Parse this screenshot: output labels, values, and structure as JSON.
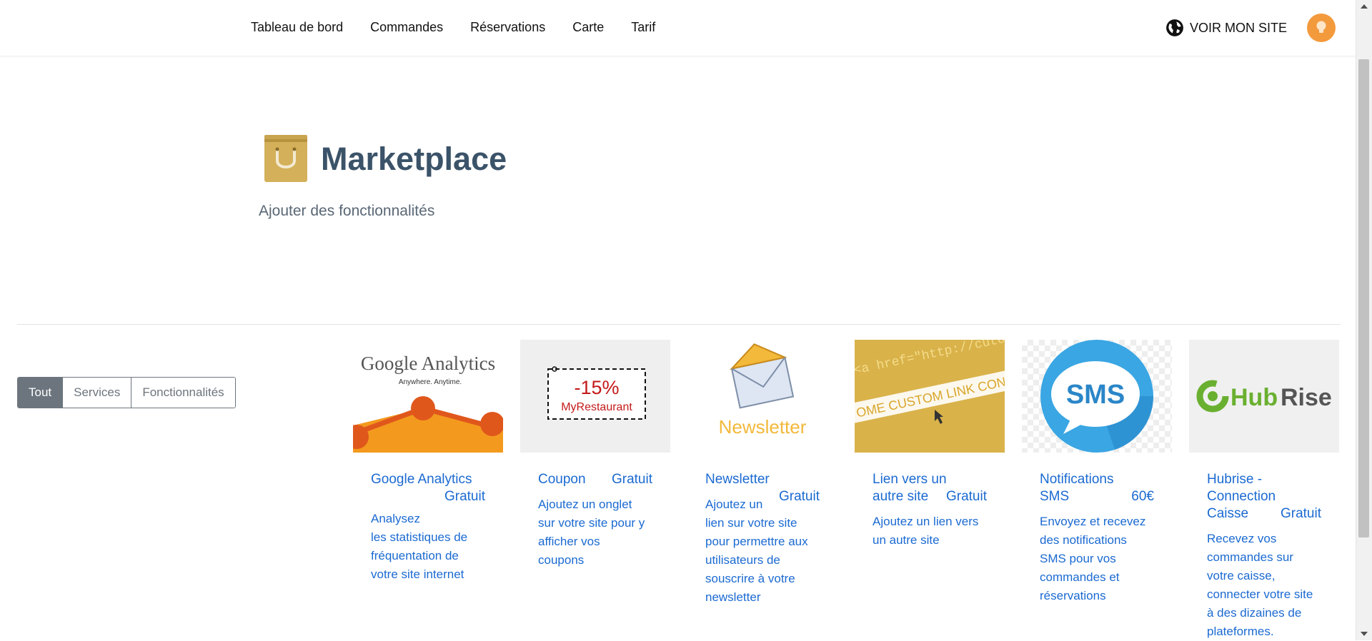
{
  "nav": {
    "items": [
      "Tableau de bord",
      "Commandes",
      "Réservations",
      "Carte",
      "Tarif"
    ],
    "site_link": "VOIR MON SITE"
  },
  "header": {
    "title": "Marketplace",
    "subtitle": "Ajouter des fonctionnalités"
  },
  "filters": [
    "Tout",
    "Services",
    "Fonctionnalités"
  ],
  "cards": [
    {
      "title_lines": [
        "Google Analytics"
      ],
      "price": "Gratuit",
      "desc_lines": [
        "Analysez",
        "les statistiques de",
        "fréquentation de",
        "votre site internet"
      ],
      "image_text": [
        "Google Analytics",
        "Anywhere. Anytime."
      ]
    },
    {
      "title_lines": [
        "Coupon"
      ],
      "price": "Gratuit",
      "desc_lines": [
        "Ajoutez un onglet",
        "sur votre site pour y",
        "afficher vos",
        "coupons"
      ],
      "image_text": [
        "-15%",
        "MyRestaurant"
      ]
    },
    {
      "title_lines": [
        "Newsletter"
      ],
      "price": "Gratuit",
      "desc_lines": [
        "Ajoutez un",
        "lien sur votre site",
        "pour permettre aux",
        "utilisateurs de",
        "souscrire à votre",
        "newsletter"
      ],
      "image_text": [
        "Newsletter"
      ]
    },
    {
      "title_lines": [
        "Lien vers un",
        "autre site"
      ],
      "price": "Gratuit",
      "desc_lines": [
        "Ajoutez un lien vers",
        "un autre site"
      ],
      "image_text": [
        "<a href=\"http://cutom.li",
        "OME CUSTOM LINK CONT"
      ]
    },
    {
      "title_lines": [
        "Notifications",
        "SMS"
      ],
      "price": "60€",
      "desc_lines": [
        "Envoyez et recevez",
        "des notifications",
        "SMS pour vos",
        "commandes et",
        "réservations"
      ],
      "image_text": [
        "SMS"
      ]
    },
    {
      "title_lines": [
        "Hubrise -",
        "Connection",
        "Caisse"
      ],
      "price": "Gratuit",
      "desc_lines": [
        "Recevez vos",
        "commandes sur",
        "votre caisse,",
        "connecter votre site",
        "à des dizaines de",
        "plateformes."
      ],
      "image_text": [
        "Hub",
        "Rise"
      ]
    }
  ],
  "colors": {
    "link_blue": "#1b6ad1",
    "title_slate": "#3b5369",
    "filter_gray": "#6c757d",
    "avatar_orange": "#f39a3d"
  }
}
